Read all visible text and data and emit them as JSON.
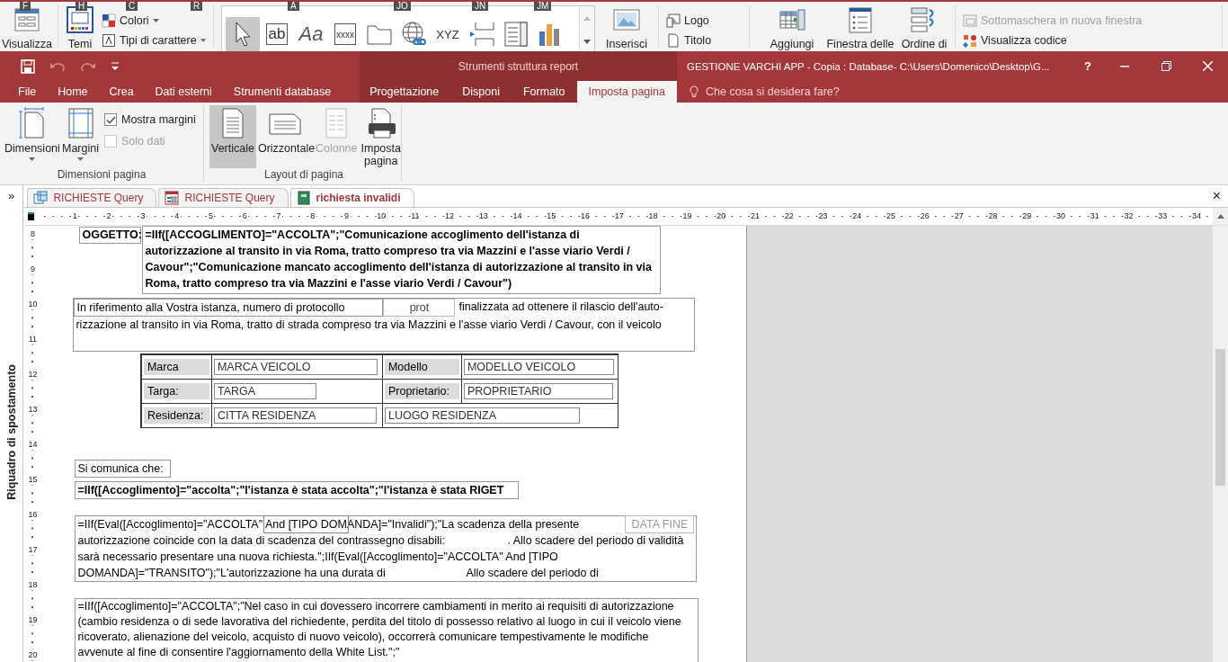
{
  "back_ribbon": {
    "key_tips": [
      "F",
      "H",
      "C",
      "R",
      "A",
      "JO",
      "JN",
      "JM"
    ],
    "items": [
      {
        "kind": "view",
        "label": "Visualizza"
      },
      {
        "kind": "themes",
        "label": "Temi"
      },
      {
        "kind": "stack",
        "entries": [
          {
            "kind": "colors",
            "label": "Colori",
            "dropdown": true,
            "disabled": false
          },
          {
            "kind": "fonts",
            "label": "Tipi di carattere",
            "dropdown": true,
            "disabled": false
          }
        ]
      },
      {
        "kind": "gallery",
        "tools": [
          {
            "kind": "pointer",
            "selected": true
          },
          {
            "kind": "textbox",
            "glyph": "ab",
            "selected": false
          },
          {
            "kind": "label",
            "glyph": "Aa",
            "selected": false
          },
          {
            "kind": "button",
            "glyph": "xxxx",
            "selected": false
          },
          {
            "kind": "tab",
            "selected": false
          },
          {
            "kind": "hyperlink",
            "selected": false
          },
          {
            "kind": "option",
            "glyph": "XYZ",
            "selected": false
          },
          {
            "kind": "pagebreak",
            "selected": false
          },
          {
            "kind": "combo",
            "selected": false
          },
          {
            "kind": "chart",
            "selected": false
          }
        ]
      },
      {
        "kind": "image",
        "label": "Inserisci"
      },
      {
        "kind": "stack",
        "entries": [
          {
            "kind": "logo",
            "label": "Logo",
            "dropdown": false,
            "disabled": false
          },
          {
            "kind": "title",
            "label": "Titolo",
            "dropdown": false,
            "disabled": false
          }
        ]
      },
      {
        "kind": "fields",
        "label": "Aggiungi"
      },
      {
        "kind": "properties",
        "label": "Finestra delle"
      },
      {
        "kind": "taborder",
        "label": "Ordine di"
      },
      {
        "kind": "stack",
        "entries": [
          {
            "kind": "subform",
            "label": "Sottomaschera in nuova finestra",
            "dropdown": false,
            "disabled": true
          },
          {
            "kind": "code",
            "label": "Visualizza codice",
            "dropdown": false,
            "disabled": false
          }
        ]
      }
    ]
  },
  "title_bar": {
    "quick_access": [
      {
        "kind": "save",
        "disabled": false
      },
      {
        "kind": "undo",
        "disabled": true
      },
      {
        "kind": "redo",
        "disabled": true
      },
      {
        "kind": "customize",
        "disabled": false
      }
    ],
    "context_title": "Strumenti struttura report",
    "title": "GESTIONE VARCHI APP - Copia : Database- C:\\Users\\Domenico\\Desktop\\G...",
    "help": "?"
  },
  "tabs": [
    {
      "label": "File",
      "selected": false,
      "contextual": false
    },
    {
      "label": "Home",
      "selected": false,
      "contextual": false
    },
    {
      "label": "Crea",
      "selected": false,
      "contextual": false
    },
    {
      "label": "Dati esterni",
      "selected": false,
      "contextual": false
    },
    {
      "label": "Strumenti database",
      "selected": false,
      "contextual": false
    },
    {
      "label": "Progettazione",
      "selected": false,
      "contextual": true
    },
    {
      "label": "Disponi",
      "selected": false,
      "contextual": true
    },
    {
      "label": "Formato",
      "selected": false,
      "contextual": true
    },
    {
      "label": "Imposta pagina",
      "selected": true,
      "contextual": true
    }
  ],
  "tell_me": {
    "placeholder": "Che cosa si desidera fare?"
  },
  "ribbon": {
    "groups": [
      {
        "title": "Dimensioni pagina",
        "buttons": [
          {
            "kind": "size",
            "label": "Dimensioni",
            "dropdown": true,
            "selected": false,
            "disabled": false
          },
          {
            "kind": "margins",
            "label": "Margini",
            "dropdown": true,
            "selected": false,
            "disabled": false
          }
        ],
        "checkboxes": [
          {
            "label": "Mostra margini",
            "checked": true,
            "disabled": false
          },
          {
            "label": "Solo dati",
            "checked": false,
            "disabled": true
          }
        ]
      },
      {
        "title": "Layout di pagina",
        "buttons": [
          {
            "kind": "portrait",
            "label": "Verticale",
            "selected": true,
            "disabled": false
          },
          {
            "kind": "landscape",
            "label": "Orizzontale",
            "selected": false,
            "disabled": false
          },
          {
            "kind": "columns",
            "label": "Colonne",
            "selected": false,
            "disabled": true
          },
          {
            "kind": "setup",
            "label": "Imposta pagina",
            "selected": false,
            "disabled": false
          }
        ]
      }
    ]
  },
  "navigation_pane": {
    "toggle": "»",
    "title": "Riquadro di spostamento"
  },
  "documents": {
    "tabs": [
      {
        "kind": "query",
        "label": "RICHIESTE Query",
        "selected": false
      },
      {
        "kind": "form",
        "label": "RICHIESTE Query",
        "selected": false
      },
      {
        "kind": "report",
        "label": "richiesta invalidi",
        "selected": true
      }
    ],
    "close": "×"
  },
  "ruler": {
    "horizontal": [
      "1",
      "2",
      "3",
      "4",
      "5",
      "6",
      "7",
      "8",
      "9",
      "10",
      "11",
      "12",
      "13",
      "14",
      "15",
      "16",
      "17",
      "18",
      "19",
      "20",
      "21",
      "22",
      "23",
      "24",
      "25",
      "26",
      "27",
      "28",
      "29",
      "30",
      "31",
      "32",
      "33",
      "34"
    ],
    "vertical": [
      "8",
      "9",
      "10",
      "11",
      "12",
      "13",
      "14",
      "15",
      "16",
      "17",
      "18",
      "19",
      "20"
    ]
  },
  "report": {
    "controls": [
      {
        "kind": "label",
        "text": "OGGETTO:",
        "bold": true
      },
      {
        "kind": "textbox",
        "text": "=IIf([ACCOGLIMENTO]=\"ACCOLTA\";\"Comunicazione accoglimento dell'istanza di autorizzazione al transito in via Roma, tratto compreso tra via Mazzini e l'asse viario Verdi / Cavour\";\"Comunicazione mancato accoglimento dell'istanza di autorizzazione al transito in via Roma, tratto compreso tra via Mazzini e l'asse viario Verdi / Cavour\")",
        "bold": true
      },
      {
        "kind": "paragraph",
        "label": "In riferimento alla Vostra istanza, numero di protocollo",
        "field": "prot",
        "lines": [
          "finalizzata ad ottenere il rilascio dell'auto-",
          "rizzazione al transito in via Roma, tratto di strada compreso tra via Mazzini e l'asse viario Verdi / Cavour, con il veicolo"
        ]
      },
      {
        "kind": "table",
        "rows": [
          [
            {
              "kind": "label",
              "text": "Marca"
            },
            {
              "kind": "field",
              "text": "MARCA VEICOLO"
            },
            {
              "kind": "label",
              "text": "Modello"
            },
            {
              "kind": "field",
              "text": "MODELLO VEICOLO"
            }
          ],
          [
            {
              "kind": "label",
              "text": "Targa:"
            },
            {
              "kind": "field",
              "text": "TARGA"
            },
            {
              "kind": "label",
              "text": "Proprietario:"
            },
            {
              "kind": "field",
              "text": "PROPRIETARIO"
            }
          ],
          [
            {
              "kind": "label",
              "text": "Residenza:"
            },
            {
              "kind": "field",
              "text": "CITTA RESIDENZA"
            },
            {
              "kind": "field",
              "text": "LUOGO RESIDENZA"
            }
          ]
        ]
      },
      {
        "kind": "label",
        "text": "Si comunica che:",
        "bold": false
      },
      {
        "kind": "textbox",
        "text": "=IIf([Accoglimento]=\"accolta\";\"l'istanza è stata accolta\";\"l'istanza è stata RIGET",
        "bold": true
      },
      {
        "kind": "textbox",
        "text": "=IIf(Eval([Accoglimento]=\"ACCOLTA\" And [TIPO DOMANDA]=\"Invalidi\");\"La scadenza della presente autorizzazione coincide con la data di scadenza del contrassegno disabili:                    . Allo scadere del periodo di validità sarà necessario presentare una nuova richiesta.\";IIf(Eval([Accoglimento]=\"ACCOLTA\" And [TIPO DOMANDA]=\"TRANSITO\");\"L'autorizzazione ha una durata di                          Allo scadere del periodo di",
        "bold": false
      },
      {
        "kind": "field",
        "text": "DATA FINE",
        "bold": false
      },
      {
        "kind": "textbox",
        "text": "=IIf([Accoglimento]=\"ACCOLTA\";\"Nel caso in cui dovessero incorrere cambiamenti in merito ai requisiti di autorizzazione (cambio residenza o di sede lavorativa del richiedente, perdita del titolo di possesso relativo al luogo in cui il veicolo viene ricoverato, alienazione del veicolo, acquisto di nuovo veicolo), occorrerà comunicare tempestivamente le modifiche avvenute al fine di consentire l'aggiornamento della White List.\";\"",
        "bold": false
      }
    ]
  }
}
